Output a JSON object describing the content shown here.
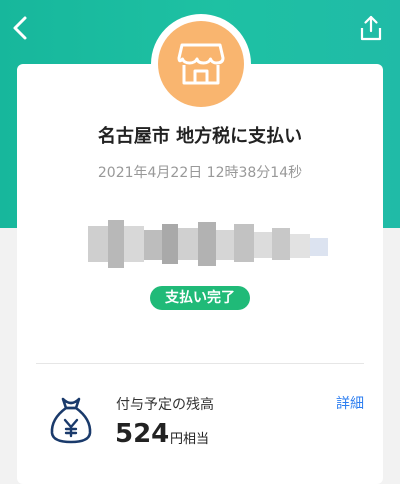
{
  "header": {
    "back_icon": "chevron-left-icon",
    "share_icon": "share-icon",
    "bg_color": "#1ec1a3"
  },
  "payment": {
    "store_icon": "storefront-icon",
    "store_icon_color": "#f9b56f",
    "merchant_name": "名古屋市 地方税に支払い",
    "datetime": "2021年4月22日 12時38分14秒",
    "status_label": "支払い完了",
    "status_color": "#20ba78"
  },
  "balance": {
    "icon": "money-bag-yen-icon",
    "label": "付与予定の残高",
    "detail_label": "詳細",
    "amount": "524",
    "unit": "円相当"
  }
}
